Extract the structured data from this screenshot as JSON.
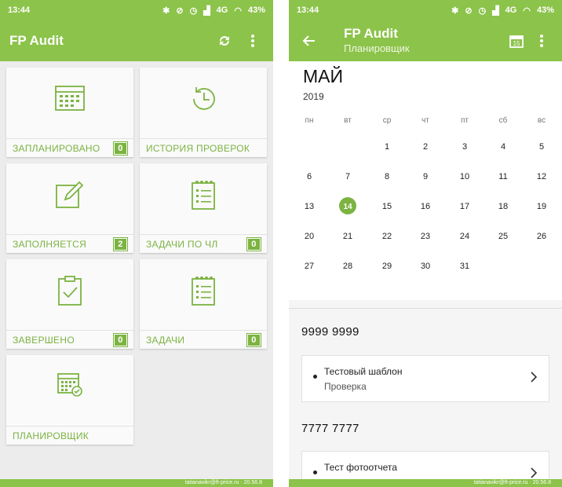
{
  "left": {
    "status": {
      "time": "13:44",
      "icons": [
        "bluetooth-icon",
        "mute-icon",
        "alarm-icon",
        "signal-icon",
        "4g-label",
        "wifi-icon",
        "battery-icon"
      ],
      "network": "4G",
      "battery": "43%"
    },
    "appbar": {
      "title": "FP Audit"
    },
    "tiles": [
      {
        "label": "ЗАПЛАНИРОВАНО",
        "badge": "0",
        "icon": "calendar-icon"
      },
      {
        "label": "ИСТОРИЯ ПРОВЕРОК",
        "badge": "",
        "icon": "history-icon"
      },
      {
        "label": "ЗАПОЛНЯЕТСЯ",
        "badge": "2",
        "icon": "edit-icon"
      },
      {
        "label": "ЗАДАЧИ ПО ЧЛ",
        "badge": "0",
        "icon": "checklist-icon"
      },
      {
        "label": "ЗАВЕРШЕНО",
        "badge": "0",
        "icon": "clipboard-check-icon"
      },
      {
        "label": "ЗАДАЧИ",
        "badge": "0",
        "icon": "checklist-icon"
      },
      {
        "label": "ПЛАНИРОВЩИК",
        "badge": "",
        "icon": "planner-icon"
      }
    ],
    "navbar": "tatianavikr@ft-price.ru · 20.56.8"
  },
  "right": {
    "status": {
      "time": "13:44",
      "network": "4G",
      "battery": "43%"
    },
    "appbar": {
      "title": "FP Audit",
      "subtitle": "Планировщик"
    },
    "calendar": {
      "month": "МАЙ",
      "year": "2019",
      "weekdays": [
        "пн",
        "вт",
        "ср",
        "чт",
        "пт",
        "сб",
        "вс"
      ],
      "today": "14",
      "rows": [
        [
          "",
          "",
          "1",
          "2",
          "3",
          "4",
          "5"
        ],
        [
          "6",
          "7",
          "8",
          "9",
          "10",
          "11",
          "12"
        ],
        [
          "13",
          "14",
          "15",
          "16",
          "17",
          "18",
          "19"
        ],
        [
          "20",
          "21",
          "22",
          "23",
          "24",
          "25",
          "26"
        ],
        [
          "27",
          "28",
          "29",
          "30",
          "31",
          "",
          ""
        ]
      ]
    },
    "sections": [
      {
        "header": "9999 9999",
        "item_title": "Тестовый шаблон",
        "item_sub": "Проверка"
      },
      {
        "header": "7777 7777",
        "item_title": "Тест фотоотчета",
        "item_sub": ""
      }
    ],
    "navbar": "tatianavikr@ft-price.ru · 20.56.8"
  },
  "colors": {
    "accent": "#8cc34a",
    "accent_dark": "#7cb342"
  }
}
